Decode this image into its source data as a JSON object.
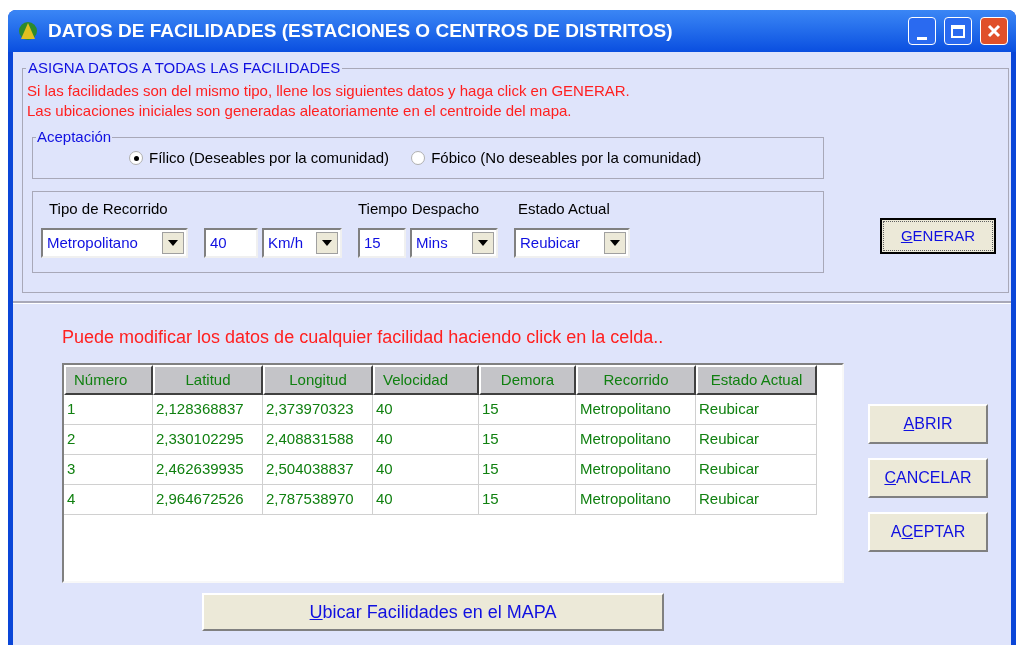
{
  "window": {
    "title": "DATOS DE FACILIDADES (ESTACIONES O CENTROS DE DISTRITOS)"
  },
  "assign_group": {
    "title": "ASIGNA DATOS A TODAS LAS FACILIDADES",
    "notes": [
      "Si las facilidades son del mismo tipo, llene los siguientes datos y haga click en GENERAR.",
      "Las ubicaciones iniciales son generadas aleatoriamente en el centroide del mapa."
    ],
    "acceptance": {
      "title": "Aceptación",
      "options": [
        {
          "label": "Fílico (Deseables por la comunidad)",
          "selected": true
        },
        {
          "label": "Fóbico (No deseables por la comunidad)",
          "selected": false
        }
      ]
    },
    "tipo_label": "Tipo de Recorrido",
    "tipo_value": "Metropolitano",
    "speed_value": "40",
    "speed_unit": "Km/h",
    "tiempo_label": "Tiempo Despacho",
    "tiempo_value": "15",
    "tiempo_unit": "Mins",
    "estado_label": "Estado Actual",
    "estado_value": "Reubicar",
    "generate_button": {
      "key": "G",
      "rest": "ENERAR"
    }
  },
  "hint": "Puede modificar los datos de cualquier facilidad haciendo click en la celda..",
  "table": {
    "columns": [
      "Número",
      "Latitud",
      "Longitud",
      "Velocidad",
      "Demora",
      "Recorrido",
      "Estado Actual"
    ],
    "rows": [
      [
        "1",
        "2,128368837",
        "2,373970323",
        "40",
        "15",
        "Metropolitano",
        "Reubicar"
      ],
      [
        "2",
        "2,330102295",
        "2,408831588",
        "40",
        "15",
        "Metropolitano",
        "Reubicar"
      ],
      [
        "3",
        "2,462639935",
        "2,504038837",
        "40",
        "15",
        "Metropolitano",
        "Reubicar"
      ],
      [
        "4",
        "2,964672526",
        "2,787538970",
        "40",
        "15",
        "Metropolitano",
        "Reubicar"
      ]
    ]
  },
  "side_buttons": [
    {
      "key": "A",
      "rest": "BRIR"
    },
    {
      "key": "C",
      "rest": "ANCELAR"
    },
    {
      "pre": "A",
      "key": "C",
      "rest": "EPTAR"
    }
  ],
  "map_button": {
    "key": "U",
    "rest": "bicar Facilidades en el MAPA"
  }
}
